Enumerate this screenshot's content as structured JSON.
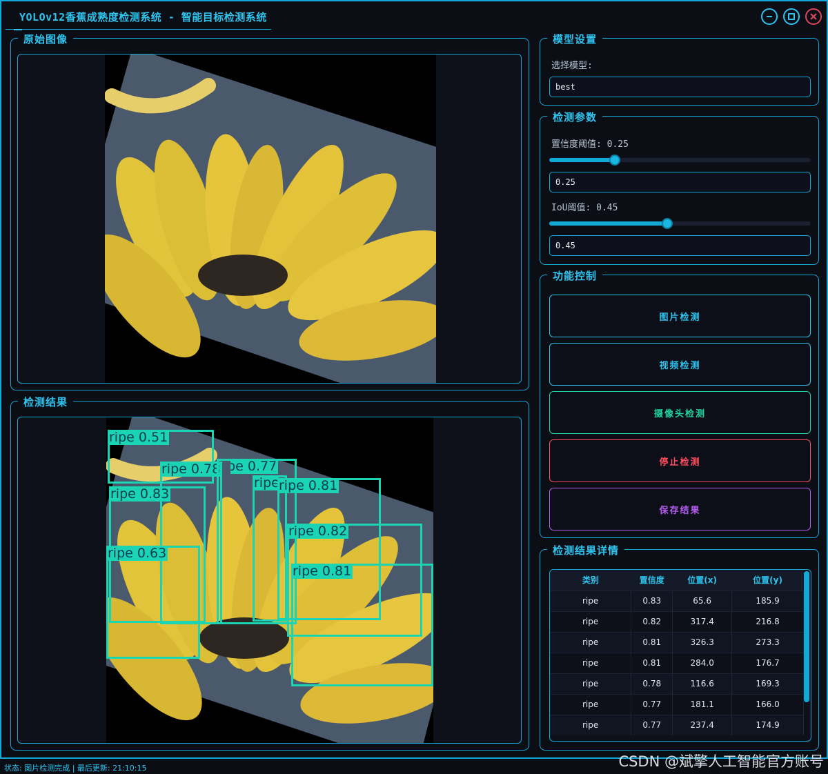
{
  "window": {
    "title": "YOLOv12香蕉成熟度检测系统 - 智能目标检测系统"
  },
  "original_panel": {
    "title": "原始图像"
  },
  "result_panel": {
    "title": "检测结果"
  },
  "detections": [
    {
      "label": "ripe 0.51"
    },
    {
      "label": "ripe 0.78"
    },
    {
      "label": "ripe 0.77"
    },
    {
      "label": "ripe 0.77"
    },
    {
      "label": "ripe 0.81"
    },
    {
      "label": "ripe 0.83"
    },
    {
      "label": "ripe 0.82"
    },
    {
      "label": "ripe 0.63"
    },
    {
      "label": "ripe 0.81"
    }
  ],
  "model_settings": {
    "title": "模型设置",
    "select_label": "选择模型:",
    "selected_model": "best"
  },
  "detect_params": {
    "title": "检测参数",
    "conf_label": "置信度阈值: 0.25",
    "conf_value": "0.25",
    "conf_level": 0.25,
    "iou_label": "IoU阈值: 0.45",
    "iou_value": "0.45",
    "iou_level": 0.45
  },
  "controls": {
    "title": "功能控制",
    "image_detect": "图片检测",
    "video_detect": "视频检测",
    "camera_detect": "摄像头检测",
    "stop_detect": "停止检测",
    "save_result": "保存结果",
    "colors": {
      "image": "#2ec4ee",
      "video": "#2ec4ee",
      "camera": "#1fd4a0",
      "stop": "#ff4d5e",
      "save": "#b45cf0"
    }
  },
  "results_table": {
    "title": "检测结果详情",
    "headers": [
      "类别",
      "置信度",
      "位置(x)",
      "位置(y)"
    ],
    "rows": [
      [
        "ripe",
        "0.83",
        "65.6",
        "185.9"
      ],
      [
        "ripe",
        "0.82",
        "317.4",
        "216.8"
      ],
      [
        "ripe",
        "0.81",
        "326.3",
        "273.3"
      ],
      [
        "ripe",
        "0.81",
        "284.0",
        "176.7"
      ],
      [
        "ripe",
        "0.78",
        "116.6",
        "169.3"
      ],
      [
        "ripe",
        "0.77",
        "181.1",
        "166.0"
      ],
      [
        "ripe",
        "0.77",
        "237.4",
        "174.9"
      ]
    ]
  },
  "status": {
    "text": "状态: 图片检测完成 | 最后更新: 21:10:15"
  },
  "watermark": "CSDN @斌擎人工智能官方账号",
  "icons": [
    "minimize-icon",
    "maximize-icon",
    "close-icon"
  ]
}
